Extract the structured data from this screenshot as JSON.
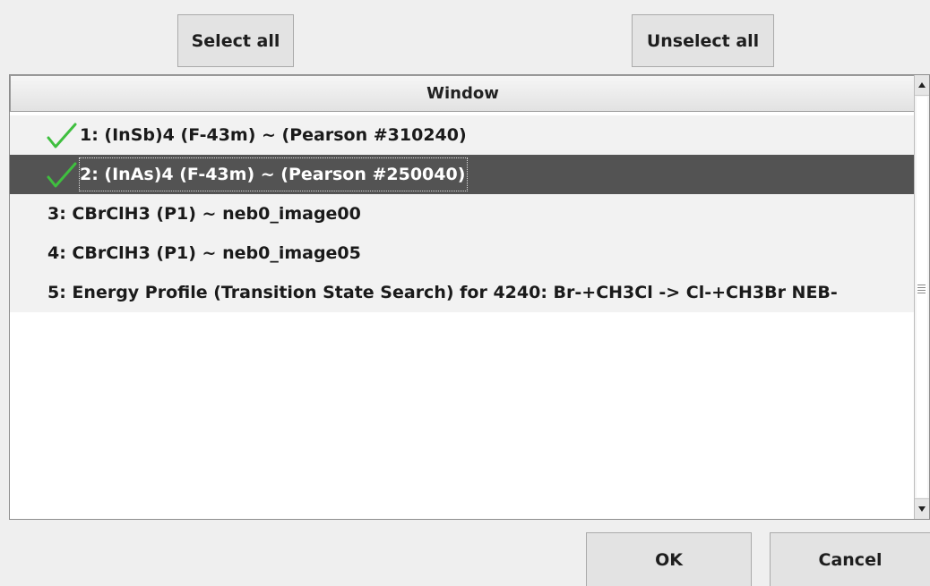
{
  "toolbar": {
    "select_all_label": "Select all",
    "unselect_all_label": "Unselect all"
  },
  "list": {
    "column_header": "Window",
    "items": [
      {
        "label": "1: (InSb)4  (F-43m) ~  (Pearson #310240)",
        "checked": true,
        "selected": false
      },
      {
        "label": "2: (InAs)4  (F-43m) ~  (Pearson #250040)",
        "checked": true,
        "selected": true
      },
      {
        "label": "3: CBrClH3  (P1) ~ neb0_image00",
        "checked": false,
        "selected": false
      },
      {
        "label": "4: CBrClH3  (P1) ~ neb0_image05",
        "checked": false,
        "selected": false
      },
      {
        "label": "5: Energy Profile (Transition State Search) for 4240: Br-+CH3Cl -> Cl-+CH3Br NEB-",
        "checked": false,
        "selected": false
      }
    ]
  },
  "footer": {
    "ok_label": "OK",
    "cancel_label": "Cancel"
  },
  "colors": {
    "check": "#3fbf3f",
    "selected_row_bg": "#535353"
  }
}
